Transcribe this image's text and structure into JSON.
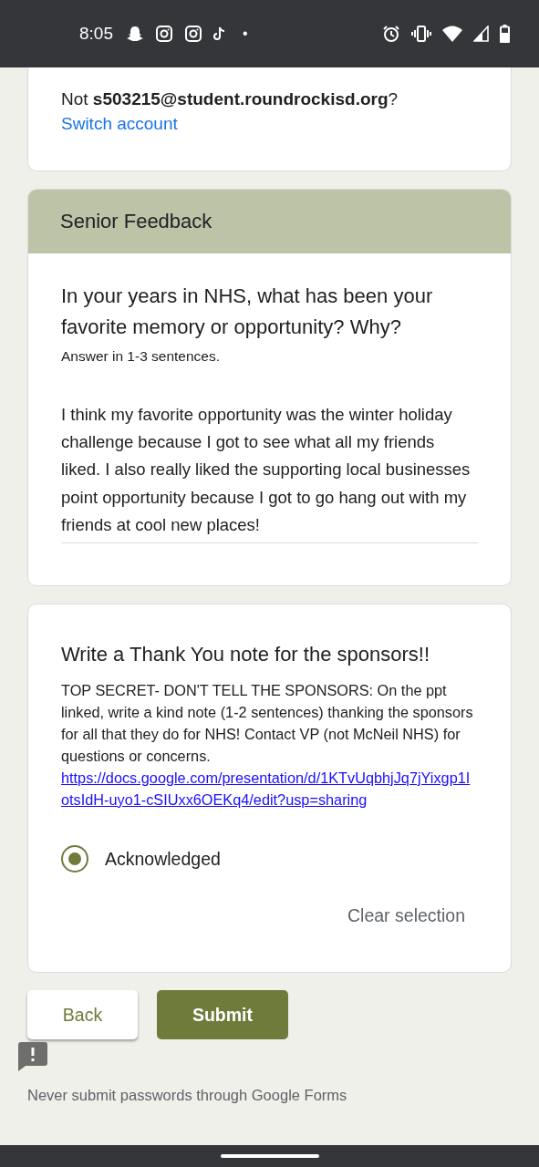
{
  "status_bar": {
    "time": "8:05",
    "notification_dot": "•"
  },
  "account": {
    "prefix": "Not ",
    "email": "s503215@student.roundrockisd.org",
    "suffix": "?",
    "switch_link": "Switch account"
  },
  "section": {
    "title": "Senior Feedback"
  },
  "question_1": {
    "title": "In your years in NHS, what has been your favorite memory or opportunity? Why?",
    "description": "Answer in 1-3 sentences.",
    "answer": "I think my favorite opportunity was the winter holiday challenge because I got to see what all my friends liked. I also really liked the supporting local businesses point opportunity because I got to go hang out with my friends at cool new places!"
  },
  "question_2": {
    "title": "Write a Thank You note for the sponsors!!",
    "description": "TOP SECRET- DON'T TELL THE SPONSORS: On the ppt linked, write a kind note (1-2 sentences) thanking the sponsors for all that they do for NHS! Contact VP (not McNeil NHS) for questions or concerns.",
    "link": "https://docs.google.com/presentation/d/1KTvUqbhjJq7jYixgp1IotsIdH-uyo1-cSIUxx6OEKq4/edit?usp=sharing",
    "options": [
      {
        "label": "Acknowledged",
        "selected": true
      }
    ],
    "clear": "Clear selection"
  },
  "buttons": [
    {
      "label": "Back",
      "kind": "secondary"
    },
    {
      "label": "Submit",
      "kind": "primary"
    }
  ],
  "footer": "Never submit passwords through Google Forms"
}
